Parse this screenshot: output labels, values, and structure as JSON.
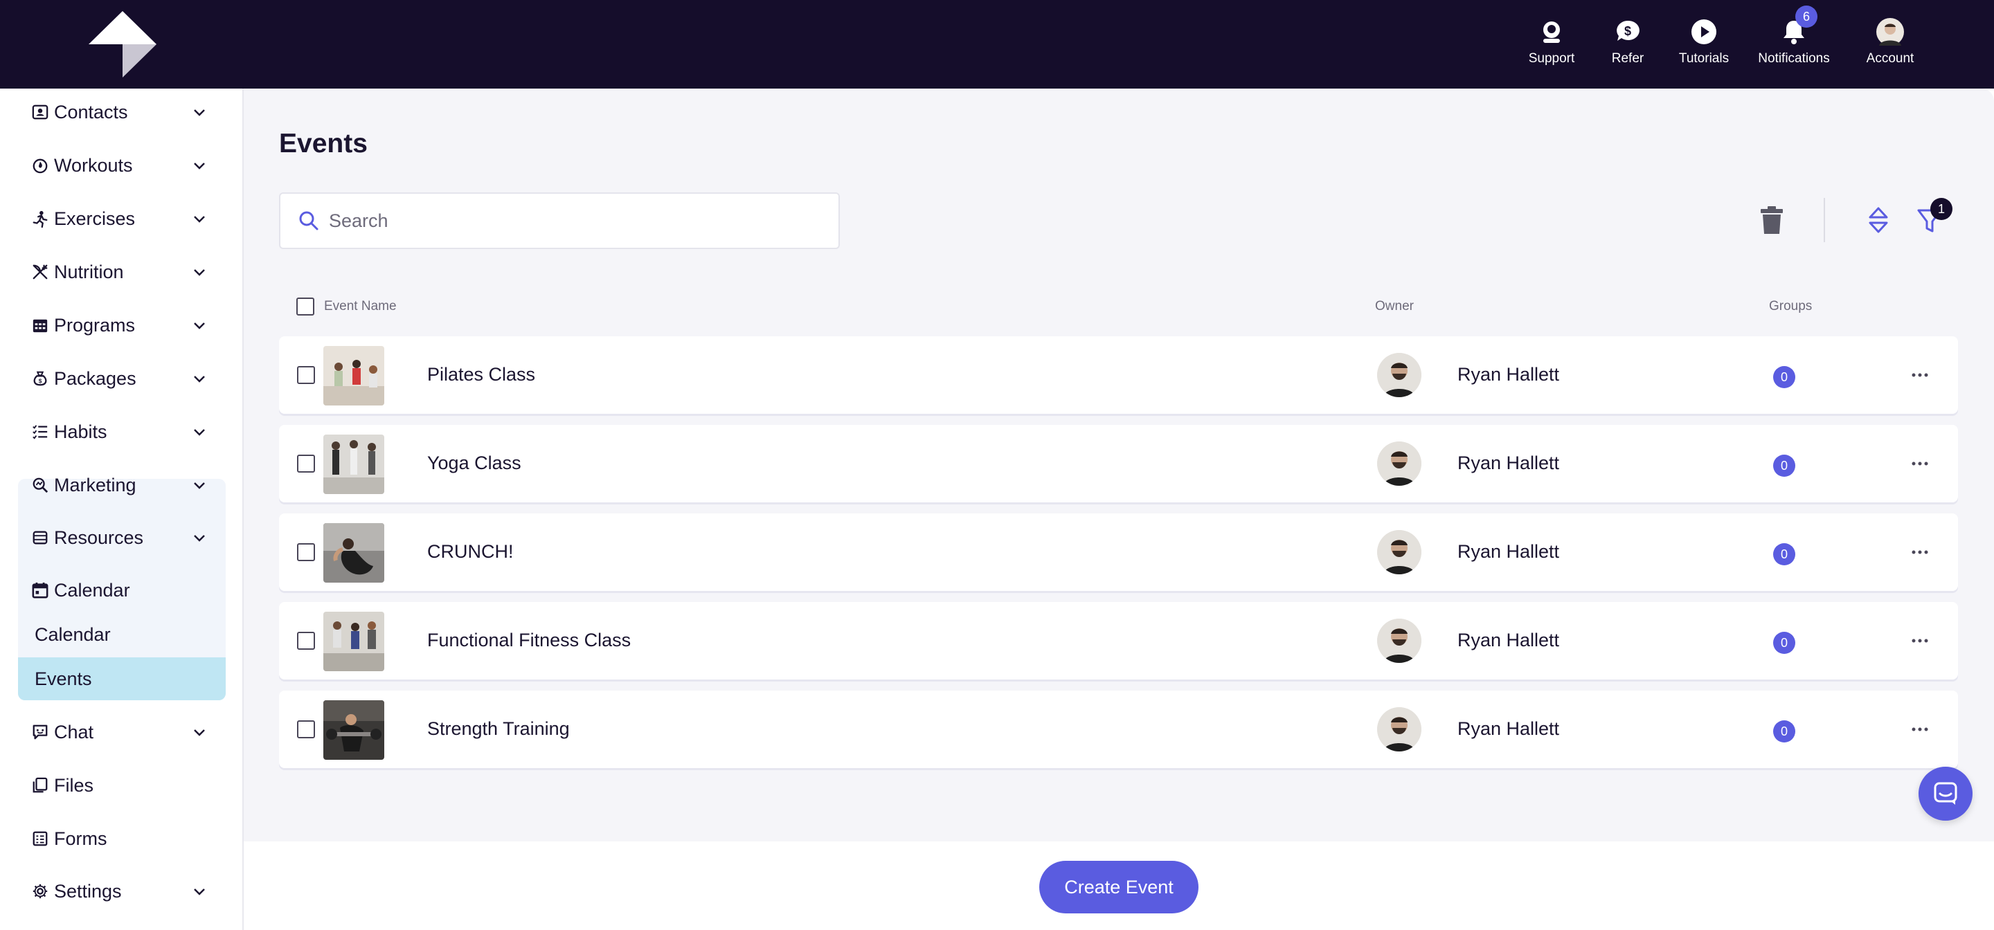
{
  "topnav": {
    "items": [
      {
        "label": "Support",
        "icon": "support-icon"
      },
      {
        "label": "Refer",
        "icon": "dollar-chat-icon"
      },
      {
        "label": "Tutorials",
        "icon": "play-icon"
      },
      {
        "label": "Notifications",
        "icon": "bell-icon",
        "badge": "6"
      },
      {
        "label": "Account",
        "icon": "avatar"
      }
    ]
  },
  "sidebar": {
    "items": [
      {
        "label": "Contacts",
        "icon": "contacts-icon"
      },
      {
        "label": "Workouts",
        "icon": "workouts-icon"
      },
      {
        "label": "Exercises",
        "icon": "exercises-icon"
      },
      {
        "label": "Nutrition",
        "icon": "nutrition-icon"
      },
      {
        "label": "Programs",
        "icon": "programs-icon"
      },
      {
        "label": "Packages",
        "icon": "packages-icon"
      },
      {
        "label": "Habits",
        "icon": "habits-icon"
      },
      {
        "label": "Marketing",
        "icon": "marketing-icon"
      },
      {
        "label": "Resources",
        "icon": "resources-icon"
      },
      {
        "label": "Calendar",
        "icon": "calendar-icon"
      },
      {
        "label": "Chat",
        "icon": "chat-icon"
      },
      {
        "label": "Files",
        "icon": "files-icon"
      },
      {
        "label": "Forms",
        "icon": "forms-icon"
      },
      {
        "label": "Settings",
        "icon": "settings-icon"
      }
    ],
    "calendar_sub": [
      "Calendar",
      "Events"
    ]
  },
  "main": {
    "title": "Events",
    "search_placeholder": "Search",
    "filter_badge": "1",
    "columns": {
      "event_name": "Event Name",
      "owner": "Owner",
      "groups": "Groups"
    },
    "rows": [
      {
        "name": "Pilates Class",
        "owner": "Ryan Hallett",
        "groups": "0"
      },
      {
        "name": "Yoga Class",
        "owner": "Ryan Hallett",
        "groups": "0"
      },
      {
        "name": "CRUNCH!",
        "owner": "Ryan Hallett",
        "groups": "0"
      },
      {
        "name": "Functional Fitness Class",
        "owner": "Ryan Hallett",
        "groups": "0"
      },
      {
        "name": "Strength Training",
        "owner": "Ryan Hallett",
        "groups": "0"
      }
    ],
    "create_label": "Create Event"
  },
  "colors": {
    "topbar": "#150d2b",
    "accent": "#5a5ce0",
    "active_sub": "#bfe6f3"
  }
}
